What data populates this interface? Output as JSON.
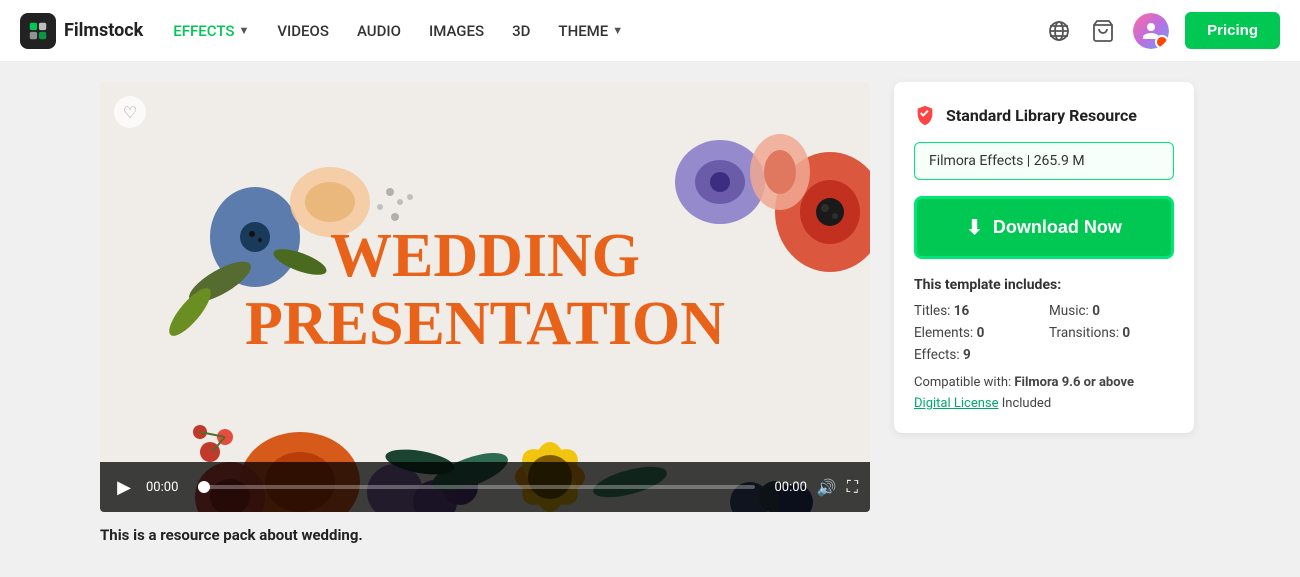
{
  "header": {
    "logo_text": "Filmstock",
    "nav": [
      {
        "id": "effects",
        "label": "EFFECTS",
        "active": true,
        "has_dropdown": true
      },
      {
        "id": "videos",
        "label": "VIDEOS",
        "active": false,
        "has_dropdown": false
      },
      {
        "id": "audio",
        "label": "AUDIO",
        "active": false,
        "has_dropdown": false
      },
      {
        "id": "images",
        "label": "IMAGES",
        "active": false,
        "has_dropdown": false
      },
      {
        "id": "3d",
        "label": "3D",
        "active": false,
        "has_dropdown": false
      },
      {
        "id": "theme",
        "label": "THEME",
        "active": false,
        "has_dropdown": true
      }
    ],
    "pricing_label": "Pricing"
  },
  "video": {
    "title_line1": "WEDDING",
    "title_line2": "PRESENTATION",
    "time_left": "00:00",
    "time_right": "00:00",
    "description": "This is a resource pack about wedding."
  },
  "sidebar": {
    "resource_badge": "Standard Library Resource",
    "file_info": "Filmora Effects | 265.9 M",
    "download_label": "Download Now",
    "template_includes_label": "This template includes:",
    "titles_label": "Titles:",
    "titles_val": "16",
    "music_label": "Music:",
    "music_val": "0",
    "elements_label": "Elements:",
    "elements_val": "0",
    "transitions_label": "Transitions:",
    "transitions_val": "0",
    "effects_label": "Effects:",
    "effects_val": "9",
    "compat_label": "Compatible with:",
    "compat_val": "Filmora 9.6 or above",
    "license_link_label": "Digital License",
    "license_suffix": "Included"
  }
}
